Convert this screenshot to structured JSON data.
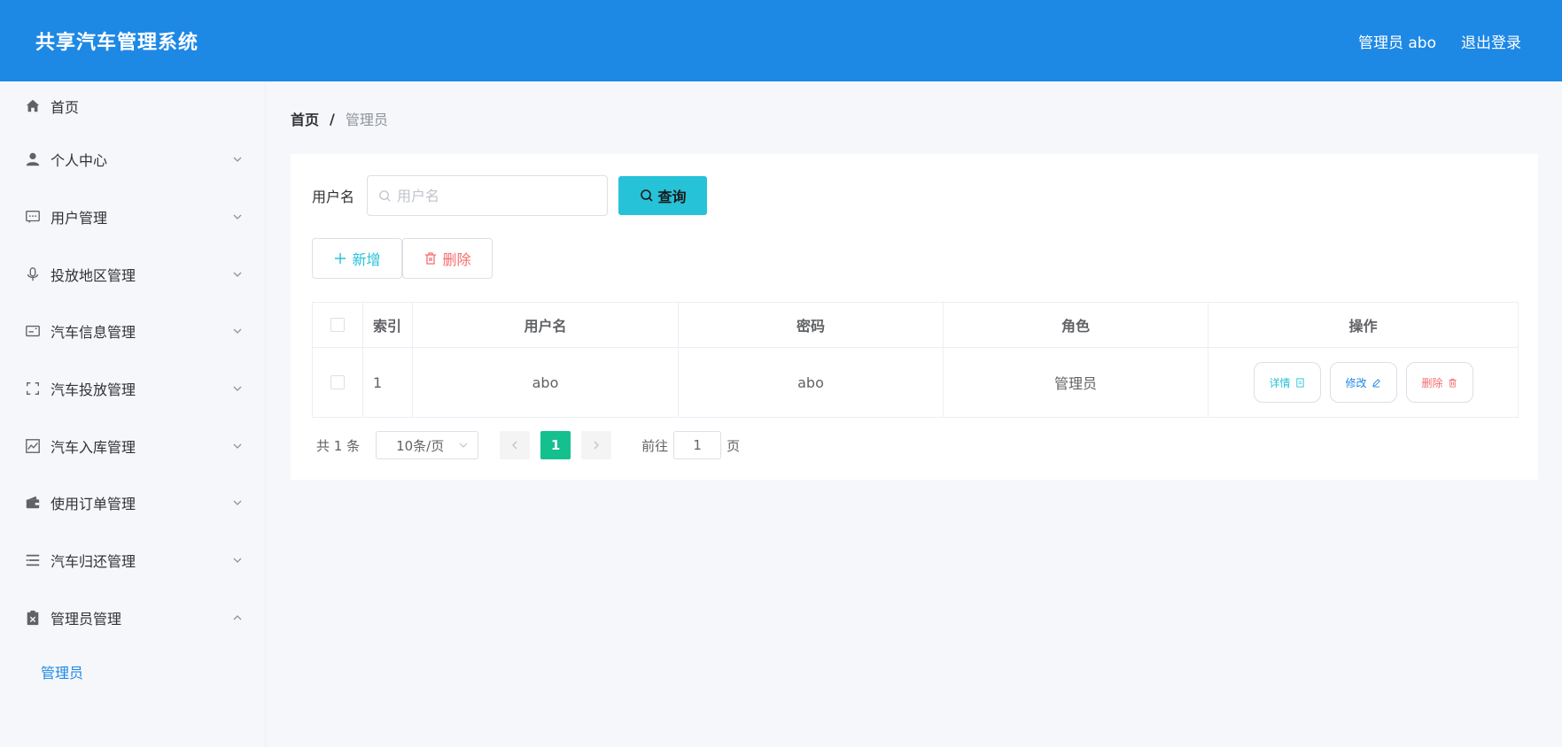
{
  "header": {
    "title": "共享汽车管理系统",
    "user_label": "管理员 abo",
    "logout_label": "退出登录"
  },
  "sidebar": {
    "items": [
      {
        "label": "首页",
        "icon": "home-icon"
      },
      {
        "label": "个人中心",
        "icon": "user-icon"
      },
      {
        "label": "用户管理",
        "icon": "chat-dots-icon"
      },
      {
        "label": "投放地区管理",
        "icon": "microphone-icon"
      },
      {
        "label": "汽车信息管理",
        "icon": "card-icon"
      },
      {
        "label": "汽车投放管理",
        "icon": "full-screen-icon"
      },
      {
        "label": "汽车入库管理",
        "icon": "trend-chart-icon"
      },
      {
        "label": "使用订单管理",
        "icon": "wallet-icon"
      },
      {
        "label": "汽车归还管理",
        "icon": "list-icon"
      },
      {
        "label": "管理员管理",
        "icon": "clipboard-x-icon"
      }
    ],
    "submenu_label": "管理员"
  },
  "breadcrumb": {
    "home": "首页",
    "separator": "/",
    "current": "管理员"
  },
  "search": {
    "label": "用户名",
    "placeholder": "用户名",
    "button_label": "查询"
  },
  "actions": {
    "add_label": "新增",
    "delete_label": "删除"
  },
  "table": {
    "headers": {
      "index": "索引",
      "username": "用户名",
      "password": "密码",
      "role": "角色",
      "ops": "操作"
    },
    "rows": [
      {
        "index": "1",
        "username": "abo",
        "password": "abo",
        "role": "管理员"
      }
    ],
    "op_labels": {
      "detail": "详情",
      "edit": "修改",
      "delete": "删除"
    }
  },
  "pagination": {
    "total": "共 1 条",
    "page_size": "10条/页",
    "current_page": "1",
    "goto_label": "前往",
    "goto_value": "1",
    "page_suffix": "页"
  },
  "colors": {
    "header_bg": "#1e88e5",
    "accent_cyan": "#26c2d8",
    "danger": "#f56c6c",
    "page_active": "#13c08e"
  }
}
